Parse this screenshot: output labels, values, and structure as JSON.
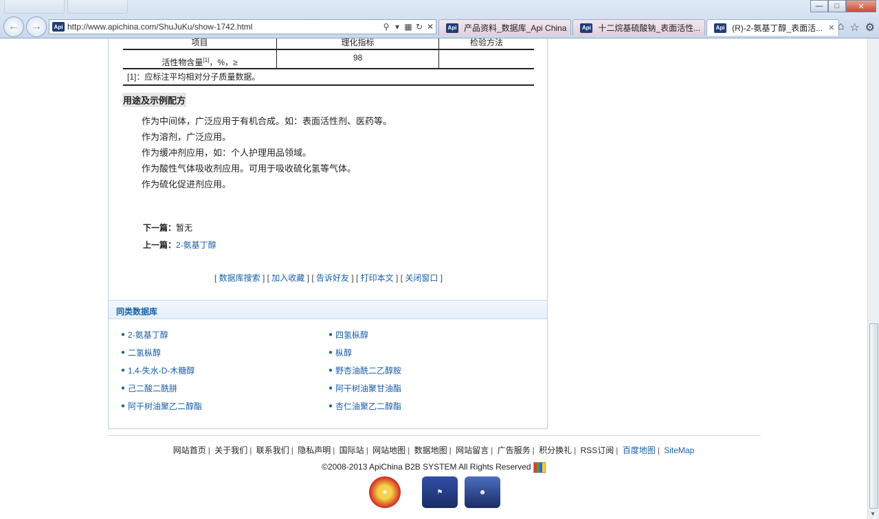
{
  "browser": {
    "url": "http://www.apichina.com/ShuJuKu/show-1742.html",
    "favicon_label": "Api",
    "window_buttons": {
      "minimize": "—",
      "maximize": "□",
      "close": "✕"
    },
    "tabs": [
      {
        "label": "产品资料_数据库_Api China",
        "active": false
      },
      {
        "label": "十二烷基硫酸钠_表面活性...",
        "active": false
      },
      {
        "label": "(R)-2-氨基丁醇_表面活...",
        "active": true
      }
    ]
  },
  "spec_table": {
    "headers": [
      "项目",
      "理化指标",
      "检验方法"
    ],
    "row": {
      "item": "活性物含量",
      "item_sup": "[1]",
      "item_suffix": "，%，≥",
      "value": "98",
      "method": ""
    },
    "note": "[1]：应标注平均相对分子质量数据。"
  },
  "usage": {
    "title": "用途及示例配方",
    "lines": [
      "作为中间体，广泛应用于有机合成。如：表面活性剂、医药等。",
      "作为溶剂，广泛应用。",
      "作为缓冲剂应用，如：个人护理用品领域。",
      "作为酸性气体吸收剂应用。可用于吸收硫化氢等气体。",
      "作为硫化促进剂应用。"
    ]
  },
  "article_nav": {
    "next_label": "下一篇：",
    "next_value": "暂无",
    "prev_label": "上一篇：",
    "prev_value": "2-氨基丁醇"
  },
  "actions": [
    "数据库搜索",
    "加入收藏",
    "告诉好友",
    "打印本文",
    "关闭窗口"
  ],
  "related": {
    "title": "同类数据库",
    "items": [
      "2-氨基丁醇",
      "四氢枞醇",
      "二氢枞醇",
      "枞醇",
      "1,4-失水-D-木糖醇",
      "野杏油酰二乙醇胺",
      "己二酸二酰肼",
      "阿干树油聚甘油酯",
      "阿干树油聚乙二醇酯",
      "杏仁油聚乙二醇酯"
    ]
  },
  "footer": {
    "links": [
      "网站首页",
      "关于我们",
      "联系我们",
      "隐私声明",
      "国际站",
      "网站地图",
      "数据地图",
      "网站留言",
      "广告服务",
      "积分换礼",
      "RSS订阅",
      "百度地图",
      "SiteMap"
    ],
    "copyright": "©2008-2013 ApiChina B2B SYSTEM All Rights Reserved"
  }
}
